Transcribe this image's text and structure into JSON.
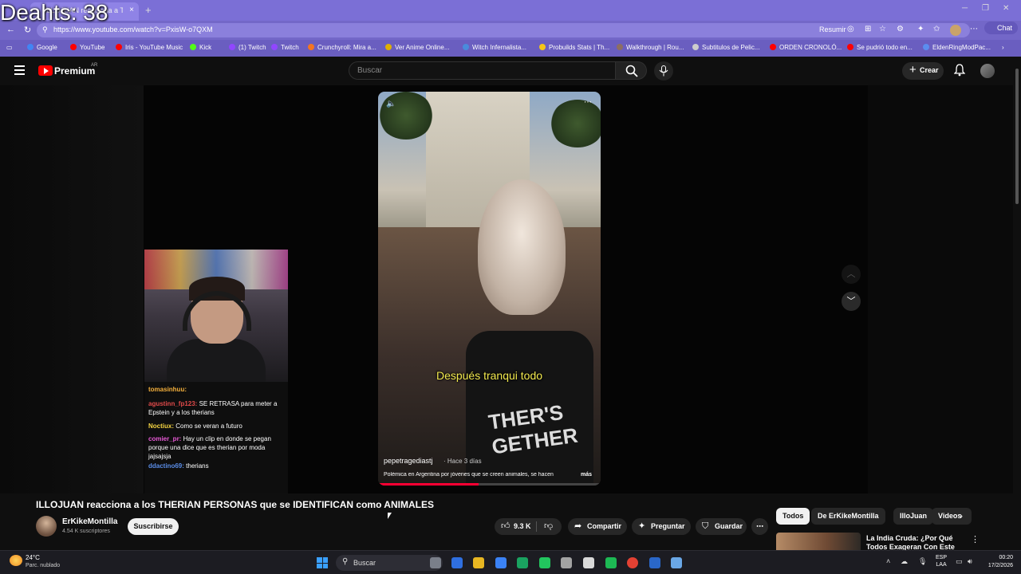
{
  "overlay": {
    "deaths_label": "Deahts: 38"
  },
  "browser": {
    "tab_title": "ILLOJUAN reacciona a THE",
    "tab_close": "×",
    "new_tab": "+",
    "url": "https://www.youtube.com/watch?v=PxisW-o7QXM",
    "resumir_label": "Resumir",
    "chat_label": "Chat",
    "bookmarks": [
      {
        "label": "Google",
        "color": "#4285f4"
      },
      {
        "label": "YouTube",
        "color": "#ff0000"
      },
      {
        "label": "Iris - YouTube Music",
        "color": "#ff0000"
      },
      {
        "label": "Kick",
        "color": "#53fc18"
      },
      {
        "label": "(1) Twitch",
        "color": "#9146ff"
      },
      {
        "label": "Twitch",
        "color": "#9146ff"
      },
      {
        "label": "Crunchyroll: Mira a...",
        "color": "#f47521"
      },
      {
        "label": "Ver Anime Online...",
        "color": "#e0b000"
      },
      {
        "label": "Witch Infernalista...",
        "color": "#4a8bdc"
      },
      {
        "label": "Probuilds Stats | Th...",
        "color": "#f5c518"
      },
      {
        "label": "Walkthrough | Rou...",
        "color": "#8d6e63"
      },
      {
        "label": "Subtitulos de Pelic...",
        "color": "#cccccc"
      },
      {
        "label": "ORDEN CRONOLÓ...",
        "color": "#ff0000"
      },
      {
        "label": "Se pudrió todo en...",
        "color": "#ff0000"
      },
      {
        "label": "EldenRingModPac...",
        "color": "#5b8def"
      }
    ]
  },
  "youtube": {
    "brand": "Premium",
    "region": "AR",
    "search_placeholder": "Buscar",
    "create_label": "Crear",
    "short": {
      "caption": "Después tranqui todo",
      "shirt_text": "THER'S GETHER",
      "channel": "pepetragediastj",
      "time": "· Hace 3 días",
      "description": "Polémica en Argentina por jóvenes que se creen animales, se hacen",
      "more": "más",
      "progress": 0.45
    },
    "stream_chat": [
      {
        "name": "tomasinhuu:",
        "name_color": "#f5b03c",
        "text": ""
      },
      {
        "name": "agustinn_fp123:",
        "name_color": "#e04a4a",
        "text": "SE RETRASA para meter a Epstein y a los therians"
      },
      {
        "name": "Noctiux:",
        "name_color": "#f5d442",
        "text": "Como se veran a futuro"
      },
      {
        "name": "comier_pr:",
        "name_color": "#e85ad6",
        "text": "Hay un clip en donde se pegan porque una dice que es therian por moda jajsajsja"
      },
      {
        "name": "ddactino69:",
        "name_color": "#5a8de8",
        "text": "therians"
      }
    ],
    "video_title": "ILLOJUAN reacciona a los THERIAN PERSONAS que se IDENTIFICAN como ANIMALES",
    "channel_name": "ErKikeMontilla",
    "subscribers": "4.54 K suscriptores",
    "subscribe_label": "Suscribirse",
    "likes": "9.3 K",
    "share_label": "Compartir",
    "ask_label": "Preguntar",
    "save_label": "Guardar",
    "chips": [
      {
        "label": "Todos",
        "active": true
      },
      {
        "label": "De ErKikeMontilla",
        "active": false
      },
      {
        "label": "IlloJuan",
        "active": false
      },
      {
        "label": "Videos",
        "active": false
      }
    ],
    "recommended_title": "La India Cruda: ¿Por Qué Todos Exageran Con Este País?"
  },
  "taskbar": {
    "temperature": "24°C",
    "weather": "Parc. nublado",
    "search_label": "Buscar",
    "lang_top": "ESP",
    "lang_bottom": "LAA",
    "time": "00:20",
    "date": "17/2/2026",
    "app_colors": [
      "#7a7f8a",
      "#2f6fe0",
      "#e7b622",
      "#3b82f6",
      "#1aa260",
      "#22c55e",
      "#a3a3a3",
      "#d9d9d9",
      "#1db954",
      "#e34133",
      "#2a67c8",
      "#6aa7e6"
    ]
  }
}
